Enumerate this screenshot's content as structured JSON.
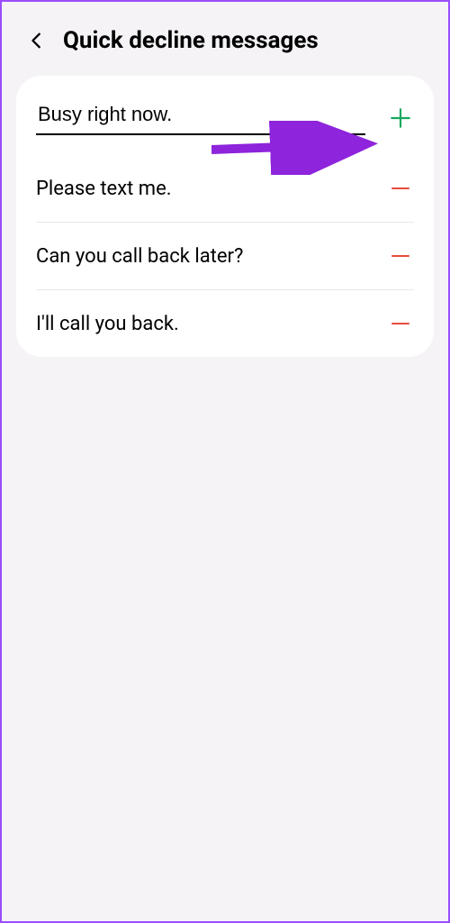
{
  "header": {
    "title": "Quick decline messages"
  },
  "input": {
    "value": "Busy right now."
  },
  "messages": [
    {
      "text": "Please text me."
    },
    {
      "text": "Can you call back later?"
    },
    {
      "text": "I'll call you back."
    }
  ],
  "colors": {
    "add": "#15a85f",
    "remove": "#e84c3d",
    "annotation": "#8e24db"
  }
}
